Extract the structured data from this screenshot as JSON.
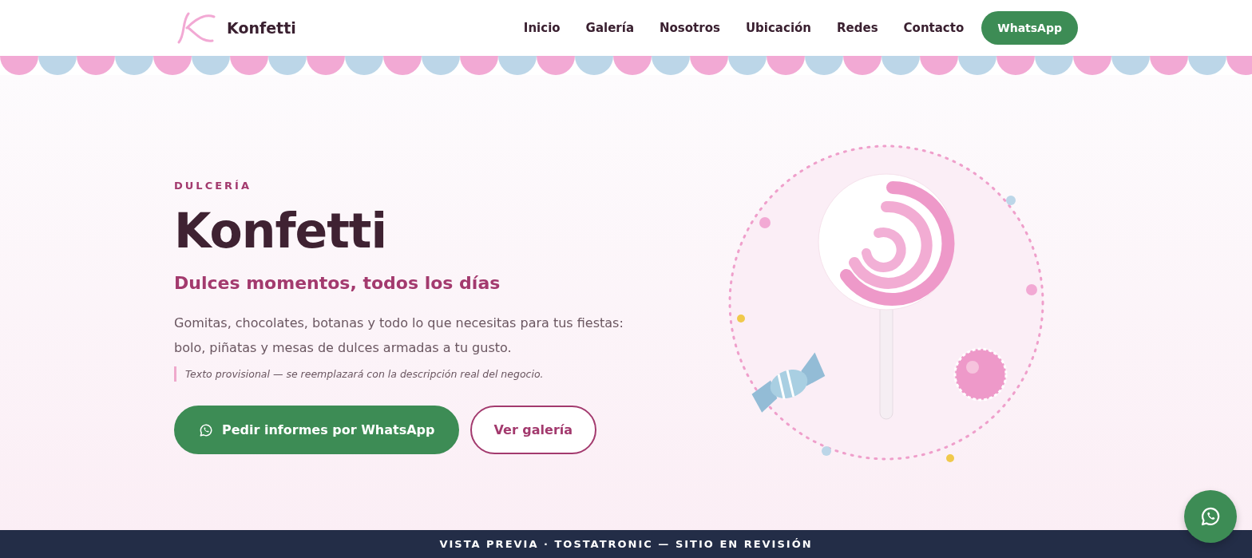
{
  "header": {
    "brand": "Konfetti",
    "nav": [
      {
        "label": "Inicio",
        "kind": "link"
      },
      {
        "label": "Galería",
        "kind": "link"
      },
      {
        "label": "Nosotros",
        "kind": "link"
      },
      {
        "label": "Ubicación",
        "kind": "link"
      },
      {
        "label": "Redes",
        "kind": "link"
      },
      {
        "label": "Contacto",
        "kind": "link"
      },
      {
        "label": "WhatsApp",
        "kind": "cta"
      }
    ]
  },
  "hero": {
    "eyebrow": "DULCERÍA",
    "title": "Konfetti",
    "subtitle": "Dulces momentos, todos los días",
    "description": "Gomitas, chocolates, botanas y todo lo que necesitas para tus fiestas: bolo, piñatas y mesas de dulces armadas a tu gusto.",
    "note": "Texto provisional — se reemplazará con la descripción real del negocio.",
    "buttons": [
      {
        "label": "Pedir informes por WhatsApp",
        "kind": "primary"
      },
      {
        "label": "Ver galería",
        "kind": "outline"
      }
    ]
  },
  "preview_bar": "VISTA PREVIA · TOSTATRONIC — SITIO EN REVISIÓN"
}
